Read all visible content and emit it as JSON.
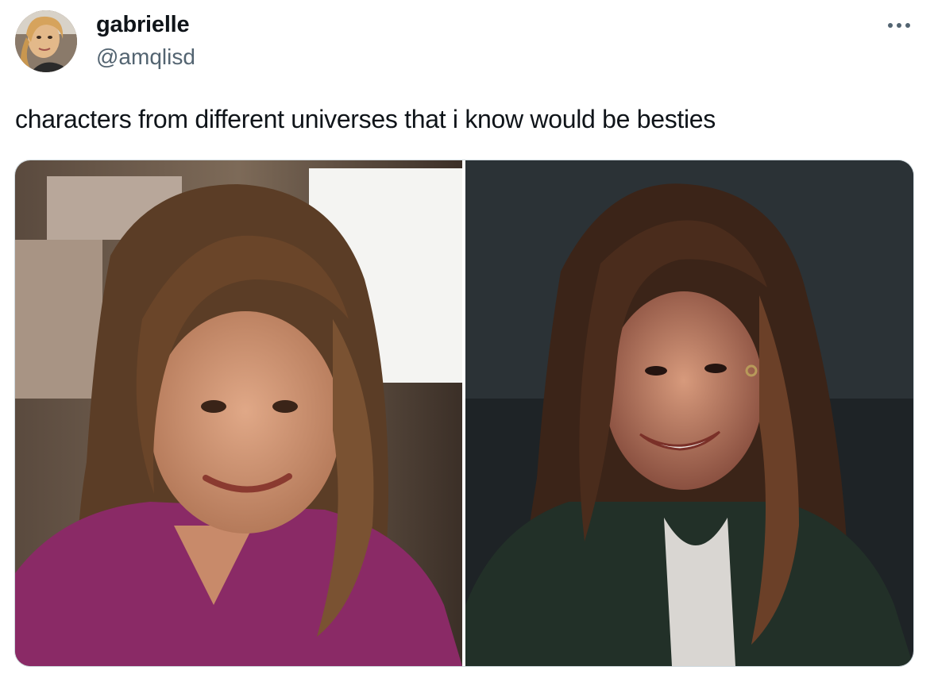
{
  "user": {
    "display_name": "gabrielle",
    "handle": "@amqlisd",
    "avatar_icon": "profile-photo"
  },
  "more_icon": "more-horizontal-icon",
  "tweet": {
    "text": "characters from different universes that i know would be besties"
  },
  "media": {
    "photos": [
      {
        "icon": "photo-woman-magenta-top"
      },
      {
        "icon": "photo-woman-night-smiling"
      }
    ]
  },
  "colors": {
    "text_primary": "#0f1419",
    "text_secondary": "#536471",
    "border": "#cfd9de"
  }
}
